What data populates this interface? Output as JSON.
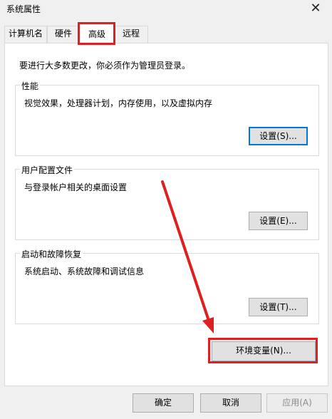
{
  "window": {
    "title": "系统属性"
  },
  "tabs": [
    {
      "label": "计算机名"
    },
    {
      "label": "硬件"
    },
    {
      "label": "高级"
    },
    {
      "label": "远程"
    }
  ],
  "notice": "要进行大多数更改，你必须作为管理员登录。",
  "groups": {
    "performance": {
      "title": "性能",
      "description": "视觉效果，处理器计划，内存使用，以及虚拟内存",
      "button": "设置(S)..."
    },
    "user_profiles": {
      "title": "用户配置文件",
      "description": "与登录帐户相关的桌面设置",
      "button": "设置(E)..."
    },
    "startup_recovery": {
      "title": "启动和故障恢复",
      "description": "系统启动、系统故障和调试信息",
      "button": "设置(T)..."
    }
  },
  "env_button": "环境变量(N)...",
  "footer": {
    "ok": "确定",
    "cancel": "取消",
    "apply": "应用(A)"
  },
  "annotation_color": "#e02020"
}
